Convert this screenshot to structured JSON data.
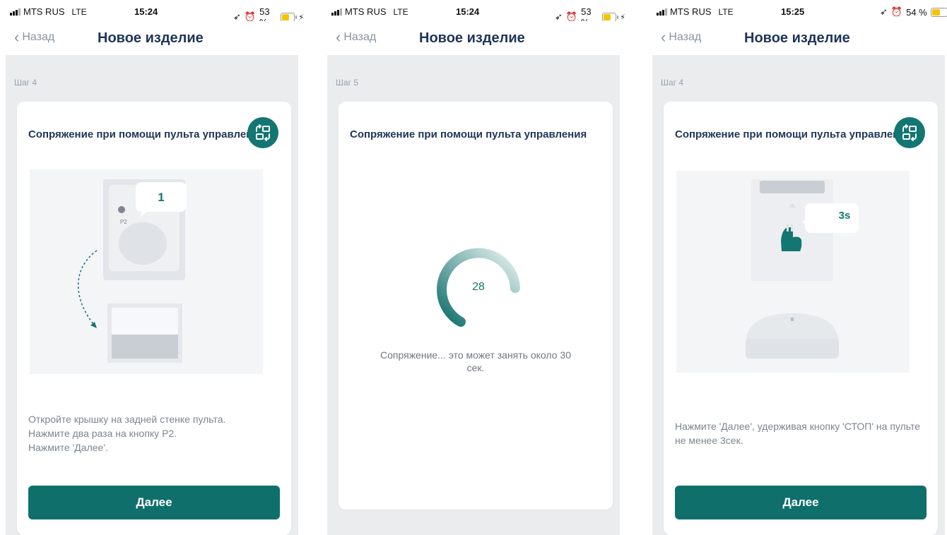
{
  "statusbars": [
    {
      "carrier": "MTS RUS",
      "network": "LTE",
      "time": "15:24",
      "battery": "53 %"
    },
    {
      "carrier": "MTS RUS",
      "network": "LTE",
      "time": "15:24",
      "battery": "53 %"
    },
    {
      "carrier": "MTS RUS",
      "network": "LTE",
      "time": "15:25",
      "battery": "54 %"
    }
  ],
  "nav": {
    "back_label": "Назад",
    "title": "Новое изделие"
  },
  "screens": [
    {
      "step": "Шаг 4",
      "card_title": "Сопряжение при помощи пульта управления",
      "bubble": "1",
      "remote_label": "P2",
      "desc": [
        "Откройте крышку на задней стенке пульта.",
        "Нажмите два раза на кнопку P2.",
        "Нажмите 'Далее'."
      ],
      "button": "Далее"
    },
    {
      "step": "Шаг 5",
      "card_title": "Сопряжение при помощи пульта управления",
      "counter": "28",
      "progress_text": "Сопряжение... это может занять около 30 сек."
    },
    {
      "step": "Шаг 4",
      "card_title": "Сопряжение при помощи пульта управления",
      "bubble": "3s",
      "desc": [
        "Нажмите 'Далее', удерживая кнопку 'СТОП' на пульте не менее 3сек."
      ],
      "button": "Далее"
    }
  ],
  "colors": {
    "accent": "#0f6f6b",
    "title": "#1f3558",
    "battery": "#f5c400"
  },
  "icons": [
    "signal-icon",
    "location-icon",
    "alarm-icon",
    "battery-icon",
    "chevron-left-icon",
    "swap-icon"
  ]
}
